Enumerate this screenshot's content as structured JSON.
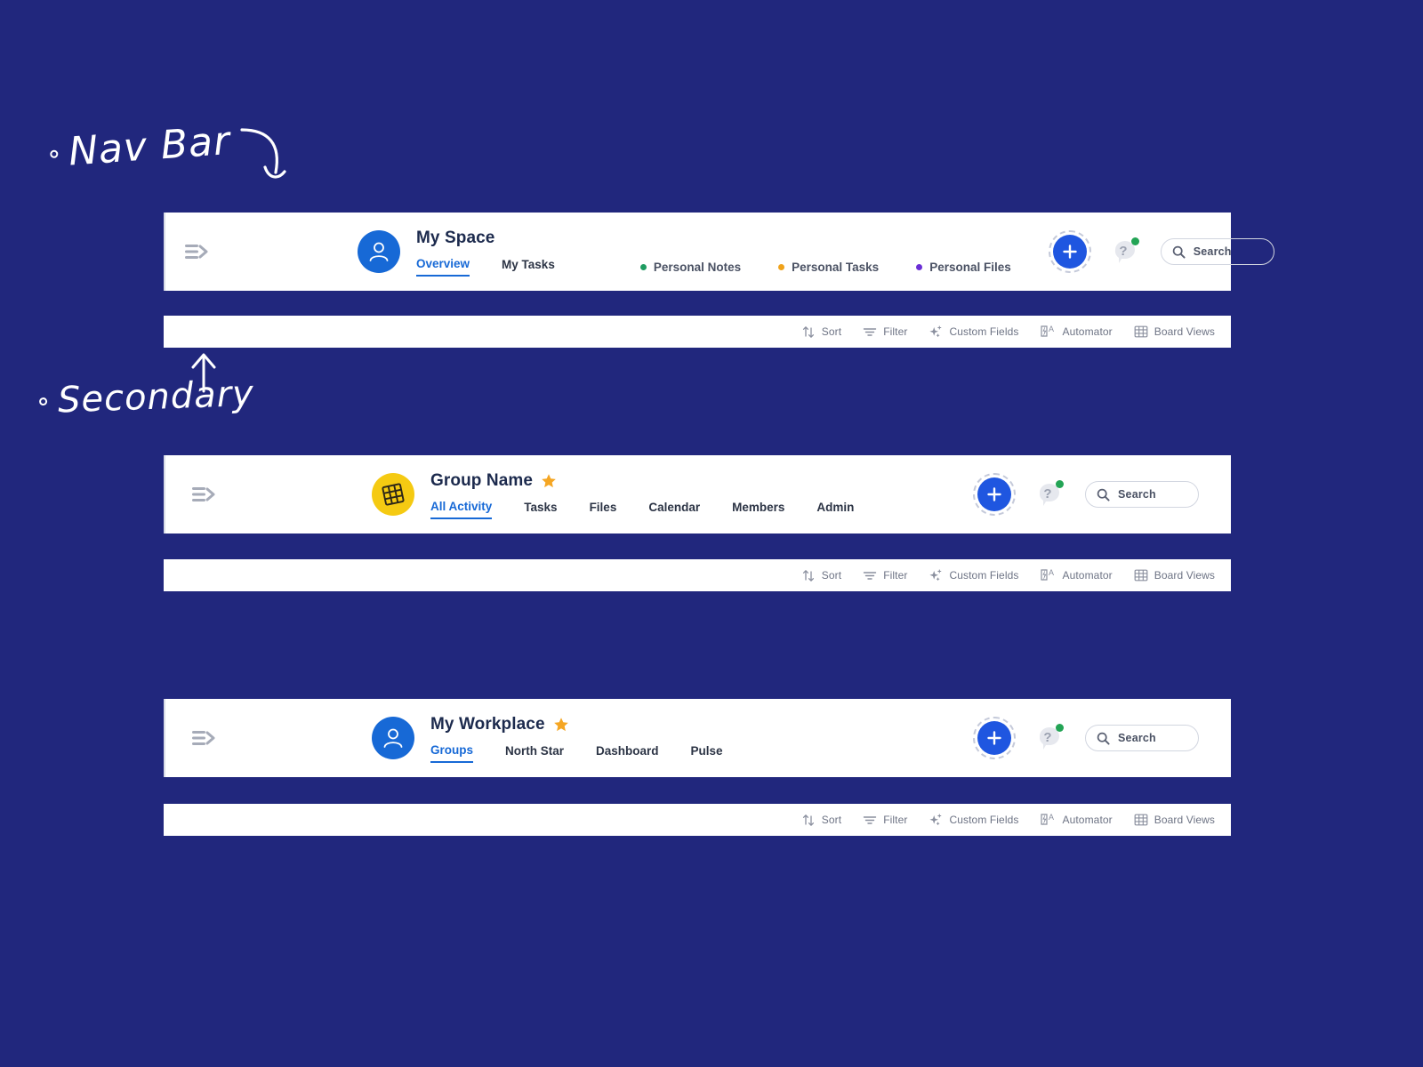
{
  "page": {
    "background_color": "#21277d",
    "annotations": [
      {
        "id": "nav-bar",
        "text": "Nav Bar"
      },
      {
        "id": "secondary",
        "text": "Secondary"
      }
    ]
  },
  "colors": {
    "accent_blue": "#1769d6",
    "plus_blue": "#1f56e0",
    "avatar_yellow": "#f5ca12",
    "star_yellow": "#f5a623",
    "badge_green": "#23a455",
    "dot_green": "#1f9c61",
    "dot_orange": "#f0a21a",
    "dot_purple": "#6b2fd6",
    "title_navy": "#1c2a4d",
    "toolbar_grey": "#6d7384"
  },
  "navbars": [
    {
      "id": "my-space",
      "menu_icon": "menu-collapse-icon",
      "avatar": {
        "type": "user-avatar-icon",
        "style": "user",
        "color": "#1769d6"
      },
      "title": "My Space",
      "starred": false,
      "tabs": [
        {
          "label": "Overview",
          "active": true
        },
        {
          "label": "My Tasks",
          "active": false
        }
      ],
      "dotted_tabs": [
        {
          "label": "Personal Notes",
          "color": "#1f9c61"
        },
        {
          "label": "Personal Tasks",
          "color": "#f0a21a"
        },
        {
          "label": "Personal Files",
          "color": "#6b2fd6"
        }
      ],
      "actions": {
        "add_button": "add-icon",
        "help_button": "help-icon",
        "help_badge": true,
        "search_placeholder": "Search"
      }
    },
    {
      "id": "group-name",
      "menu_icon": "menu-collapse-icon",
      "avatar": {
        "type": "grid-avatar-icon",
        "style": "grid",
        "color": "#f5ca12"
      },
      "title": "Group Name",
      "starred": true,
      "tabs": [
        {
          "label": "All Activity",
          "active": true
        },
        {
          "label": "Tasks",
          "active": false
        },
        {
          "label": "Files",
          "active": false
        },
        {
          "label": "Calendar",
          "active": false
        },
        {
          "label": "Members",
          "active": false
        },
        {
          "label": "Admin",
          "active": false
        }
      ],
      "dotted_tabs": [],
      "actions": {
        "add_button": "add-icon",
        "help_button": "help-icon",
        "help_badge": true,
        "search_placeholder": "Search"
      }
    },
    {
      "id": "my-workplace",
      "menu_icon": "menu-collapse-icon",
      "avatar": {
        "type": "user-avatar-icon",
        "style": "user",
        "color": "#1769d6"
      },
      "title": "My Workplace",
      "starred": true,
      "tabs": [
        {
          "label": "Groups",
          "active": true
        },
        {
          "label": "North Star",
          "active": false
        },
        {
          "label": "Dashboard",
          "active": false
        },
        {
          "label": "Pulse",
          "active": false
        }
      ],
      "dotted_tabs": [],
      "actions": {
        "add_button": "add-icon",
        "help_button": "help-icon",
        "help_badge": true,
        "search_placeholder": "Search"
      }
    }
  ],
  "secondary_toolbar": {
    "items": [
      {
        "label": "Sort",
        "icon": "sort-icon"
      },
      {
        "label": "Filter",
        "icon": "filter-icon"
      },
      {
        "label": "Custom Fields",
        "icon": "sparkle-icon"
      },
      {
        "label": "Automator",
        "icon": "automator-icon"
      },
      {
        "label": "Board Views",
        "icon": "grid-icon"
      }
    ]
  }
}
